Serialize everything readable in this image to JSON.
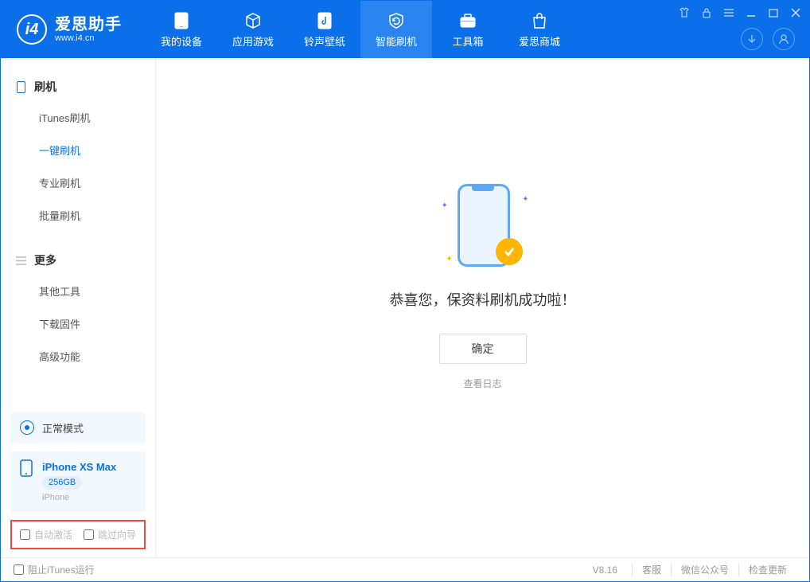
{
  "app": {
    "name": "爱思助手",
    "url": "www.i4.cn"
  },
  "nav": {
    "items": [
      {
        "label": "我的设备"
      },
      {
        "label": "应用游戏"
      },
      {
        "label": "铃声壁纸"
      },
      {
        "label": "智能刷机"
      },
      {
        "label": "工具箱"
      },
      {
        "label": "爱思商城"
      }
    ],
    "active_index": 3
  },
  "sidebar": {
    "group1": {
      "title": "刷机",
      "items": [
        "iTunes刷机",
        "一键刷机",
        "专业刷机",
        "批量刷机"
      ],
      "active_index": 1
    },
    "group2": {
      "title": "更多",
      "items": [
        "其他工具",
        "下载固件",
        "高级功能"
      ]
    }
  },
  "mode": {
    "label": "正常模式"
  },
  "device": {
    "name": "iPhone XS Max",
    "capacity": "256GB",
    "type": "iPhone"
  },
  "options": {
    "auto_activate": "自动激活",
    "skip_guide": "跳过向导"
  },
  "main": {
    "success_text": "恭喜您，保资料刷机成功啦！",
    "ok_label": "确定",
    "log_link": "查看日志"
  },
  "statusbar": {
    "block_itunes": "阻止iTunes运行",
    "version": "V8.16",
    "links": [
      "客服",
      "微信公众号",
      "检查更新"
    ]
  }
}
